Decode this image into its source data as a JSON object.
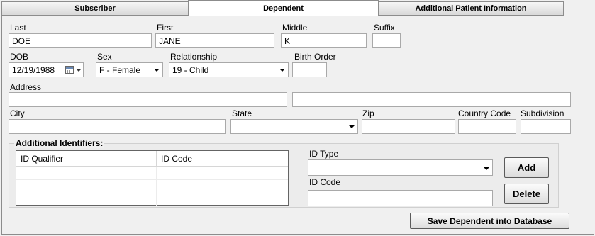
{
  "tabs": [
    {
      "label": "Subscriber"
    },
    {
      "label": "Dependent"
    },
    {
      "label": "Additional Patient Information"
    }
  ],
  "name": {
    "last_label": "Last",
    "last_value": "DOE",
    "first_label": "First",
    "first_value": "JANE",
    "middle_label": "Middle",
    "middle_value": "K",
    "suffix_label": "Suffix",
    "suffix_value": ""
  },
  "details": {
    "dob_label": "DOB",
    "dob_value": "12/19/1988",
    "sex_label": "Sex",
    "sex_value": "F - Female",
    "relationship_label": "Relationship",
    "relationship_value": "19 -  Child",
    "birth_order_label": "Birth Order",
    "birth_order_value": ""
  },
  "address": {
    "address_label": "Address",
    "line1": "",
    "line2": "",
    "city_label": "City",
    "city_value": "",
    "state_label": "State",
    "state_value": "",
    "zip_label": "Zip",
    "zip_value": "",
    "country_label": "Country Code",
    "country_value": "",
    "subdivision_label": "Subdivision",
    "subdivision_value": ""
  },
  "identifiers": {
    "title": "Additional Identifiers:",
    "columns": [
      "ID Qualifier",
      "ID Code"
    ],
    "id_type_label": "ID Type",
    "id_type_value": "",
    "id_code_label": "ID Code",
    "id_code_value": "",
    "add_label": "Add",
    "delete_label": "Delete"
  },
  "save_label": "Save Dependent into Database"
}
